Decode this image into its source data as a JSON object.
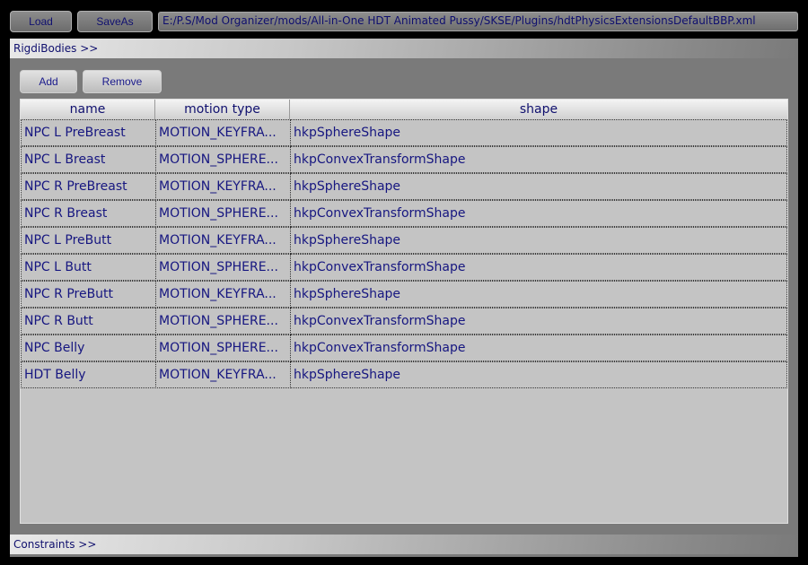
{
  "toolbar": {
    "load_label": "Load",
    "saveas_label": "SaveAs",
    "path_value": "E:/P.S/Mod Organizer/mods/All-in-One HDT Animated Pussy/SKSE/Plugins/hdtPhysicsExtensionsDefaultBBP.xml"
  },
  "rigid_bodies": {
    "header": "RigdiBodies >>",
    "add_label": "Add",
    "remove_label": "Remove",
    "columns": [
      "name",
      "motion type",
      "shape"
    ],
    "rows": [
      {
        "name": "NPC L PreBreast",
        "motion": "MOTION_KEYFRA...",
        "shape": "hkpSphereShape"
      },
      {
        "name": "NPC L Breast",
        "motion": "MOTION_SPHERE...",
        "shape": "hkpConvexTransformShape"
      },
      {
        "name": "NPC R PreBreast",
        "motion": "MOTION_KEYFRA...",
        "shape": "hkpSphereShape"
      },
      {
        "name": "NPC R Breast",
        "motion": "MOTION_SPHERE...",
        "shape": "hkpConvexTransformShape"
      },
      {
        "name": "NPC L PreButt",
        "motion": "MOTION_KEYFRA...",
        "shape": "hkpSphereShape"
      },
      {
        "name": "NPC L Butt",
        "motion": "MOTION_SPHERE...",
        "shape": "hkpConvexTransformShape"
      },
      {
        "name": "NPC R PreButt",
        "motion": "MOTION_KEYFRA...",
        "shape": "hkpSphereShape"
      },
      {
        "name": "NPC R Butt",
        "motion": "MOTION_SPHERE...",
        "shape": "hkpConvexTransformShape"
      },
      {
        "name": "NPC Belly",
        "motion": "MOTION_SPHERE...",
        "shape": "hkpConvexTransformShape"
      },
      {
        "name": "HDT Belly",
        "motion": "MOTION_KEYFRA...",
        "shape": "hkpSphereShape"
      }
    ]
  },
  "constraints": {
    "header": "Constraints >>"
  }
}
